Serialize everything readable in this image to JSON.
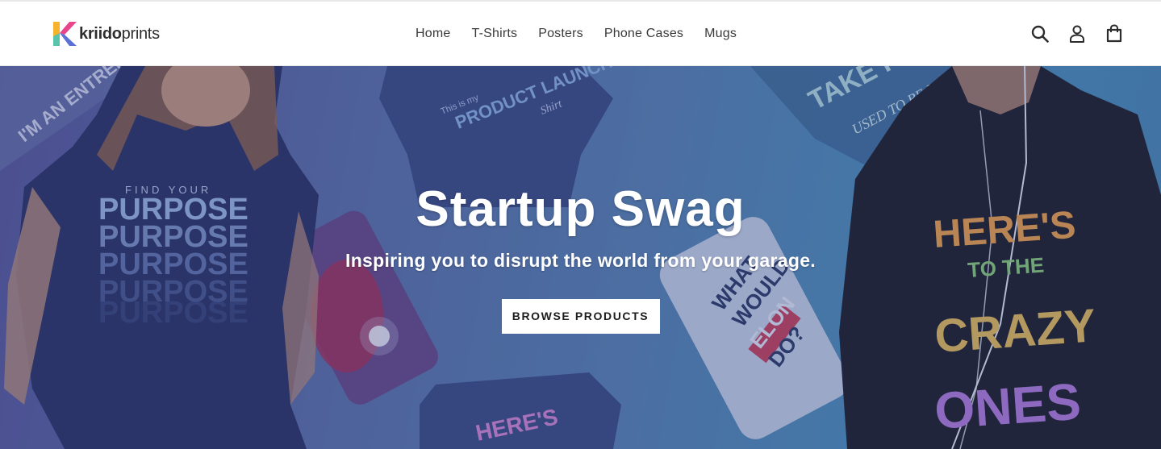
{
  "brand": {
    "name_bold": "kriido",
    "name_light": "prints",
    "logo_colors": [
      "#f7b32b",
      "#e8458b",
      "#5b6fd8",
      "#3ec6c2"
    ]
  },
  "nav": {
    "items": [
      {
        "label": "Home"
      },
      {
        "label": "T-Shirts"
      },
      {
        "label": "Posters"
      },
      {
        "label": "Phone Cases"
      },
      {
        "label": "Mugs"
      }
    ]
  },
  "header_icons": [
    "search-icon",
    "account-icon",
    "cart-icon"
  ],
  "hero": {
    "title": "Startup Swag",
    "subtitle": "Inspiring you to disrupt the world from your garage.",
    "button_label": "BROWSE PRODUCTS"
  },
  "hero_graphics": {
    "left_shirt": {
      "kicker": "FIND YOUR",
      "repeat_word": "PURPOSE"
    },
    "top_left_corner": "I'M AN ENTREPRENEUR",
    "top_center_shirt": "PRODUCT LAUNCH DAY",
    "top_center_script": "This is my",
    "top_center_suffix": "Shirt",
    "top_right_shirt": "TAKE PASSION",
    "top_right_script": "USED TO BE IS YOUR",
    "phone_case": [
      "WHAT",
      "WOULD",
      "ELON",
      "DO?"
    ],
    "right_shirt": [
      "HERE'S",
      "TO THE",
      "CRAZY",
      "ONES"
    ],
    "bottom_center_shirt": "HERE'S"
  },
  "colors": {
    "accent": "#1c1c1c",
    "hero_blue": "#5a86b6",
    "header_bg": "#ffffff"
  }
}
